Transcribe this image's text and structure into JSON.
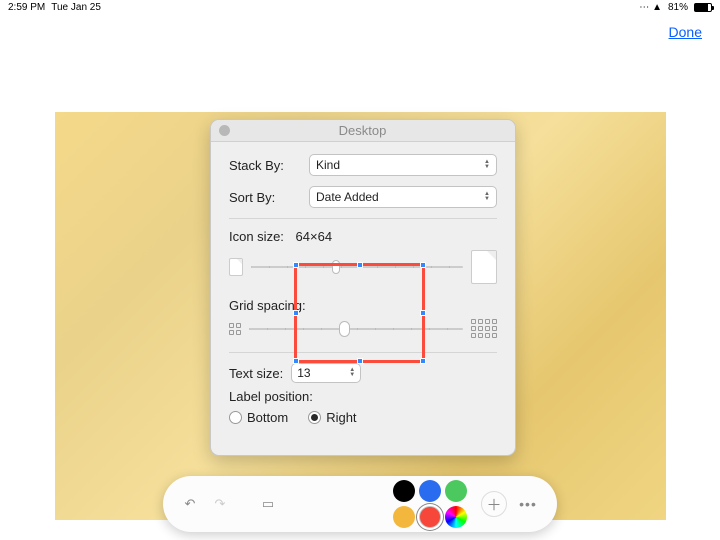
{
  "status": {
    "time": "2:59 PM",
    "date": "Tue Jan 25",
    "battery": "81%"
  },
  "nav": {
    "done": "Done"
  },
  "panel": {
    "title": "Desktop",
    "stackBy": {
      "label": "Stack By:",
      "value": "Kind"
    },
    "sortBy": {
      "label": "Sort By:",
      "value": "Date Added"
    },
    "iconSize": {
      "label": "Icon size:",
      "value": "64×64"
    },
    "gridSpacing": {
      "label": "Grid spacing:"
    },
    "textSize": {
      "label": "Text size:",
      "value": "13"
    },
    "labelPos": {
      "label": "Label position:",
      "options": [
        "Bottom",
        "Right"
      ],
      "selected": "Right"
    }
  },
  "markup": {
    "shape": {
      "type": "rectangle",
      "stroke": "#fa4b3c"
    },
    "colors": [
      "#000000",
      "#2a6cf0",
      "#4bc95e",
      "#f3b73e",
      "#f6473a",
      "multicolor"
    ],
    "selectedColor": "#f6473a"
  }
}
